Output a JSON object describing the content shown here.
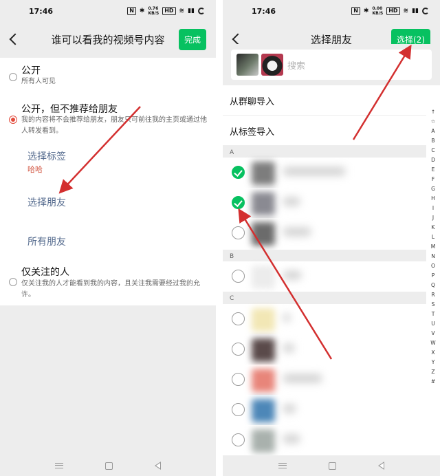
{
  "left": {
    "status": {
      "time": "17:46",
      "net": "0.76\nKB/S",
      "hd": "HD"
    },
    "title": "谁可以看我的视频号内容",
    "done_button": "完成",
    "options": [
      {
        "title": "公开",
        "desc": "所有人可见",
        "selected": false
      },
      {
        "title": "公开，但不推荐给朋友",
        "desc": "我的内容将不会推荐给朋友，朋友只可前往我的主页或通过他人转发看到。",
        "selected": true
      },
      {
        "title": "仅关注的人",
        "desc": "仅关注我的人才能看到我的内容，且关注我需要经过我的允许。",
        "selected": false
      }
    ],
    "sub": {
      "select_tag": "选择标签",
      "tag_value": "哈哈",
      "select_friends": "选择朋友",
      "all_friends": "所有朋友"
    }
  },
  "right": {
    "status": {
      "time": "17:46",
      "net": "0.00\nKB/S",
      "hd": "HD"
    },
    "title": "选择朋友",
    "select_button": "选择(2)",
    "search_placeholder": "搜索",
    "import_group": "从群聊导入",
    "import_tag": "从标签导入",
    "sections": [
      "A",
      "B",
      "C"
    ],
    "index_letters": [
      "↑",
      "☆",
      "A",
      "B",
      "C",
      "D",
      "E",
      "F",
      "G",
      "H",
      "I",
      "J",
      "K",
      "L",
      "M",
      "N",
      "O",
      "P",
      "Q",
      "R",
      "S",
      "T",
      "U",
      "V",
      "W",
      "X",
      "Y",
      "Z",
      "#"
    ],
    "contacts": [
      {
        "section": "A",
        "checked": true,
        "color": "#7d7d7d"
      },
      {
        "section": "A",
        "checked": true,
        "color": "#8a8a92"
      },
      {
        "section": "A",
        "checked": false,
        "color": "#6b6b6b"
      },
      {
        "section": "B",
        "checked": false,
        "color": "#ececec"
      },
      {
        "section": "C",
        "checked": false,
        "color": "#f2e7b5"
      },
      {
        "section": "C",
        "checked": false,
        "color": "#5a4a4a"
      },
      {
        "section": "C",
        "checked": false,
        "color": "#e8857a"
      },
      {
        "section": "C",
        "checked": false,
        "color": "#4d87b8"
      },
      {
        "section": "C",
        "checked": false,
        "color": "#a9b1ad"
      }
    ]
  },
  "colors": {
    "accent_green": "#07c160",
    "radio_red": "#e24a3b",
    "link_blue": "#556b8e",
    "arrow_red": "#d32f2f"
  }
}
